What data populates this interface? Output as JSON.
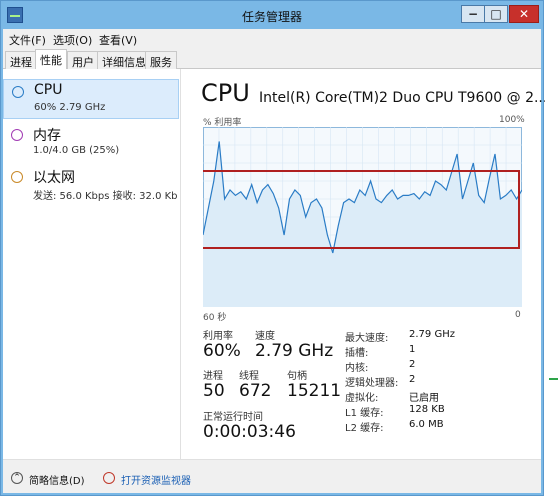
{
  "window": {
    "title": "任务管理器"
  },
  "menu": [
    "文件(F)",
    "选项(O)",
    "查看(V)"
  ],
  "tabs": [
    "进程",
    "性能",
    "用户",
    "详细信息",
    "服务"
  ],
  "active_tab": 1,
  "sidebar": [
    {
      "name": "CPU",
      "detail": "60% 2.79 GHz",
      "color": "#2a7cc6"
    },
    {
      "name": "内存",
      "detail": "1.0/4.0 GB (25%)",
      "color": "#a23cb4"
    },
    {
      "name": "以太网",
      "detail": "发送: 56.0 Kbps 接收: 32.0 Kb",
      "color": "#c98a2a"
    }
  ],
  "main": {
    "title": "CPU",
    "model": "Intel(R) Core(TM)2 Duo CPU T9600 @ 2...",
    "graph_label_left": "% 利用率",
    "graph_label_right": "100%",
    "graph_label_bottom_left": "60 秒",
    "graph_label_bottom_right": "0"
  },
  "stats": {
    "util_label": "利用率",
    "util_value": "60%",
    "speed_label": "速度",
    "speed_value": "2.79 GHz",
    "proc_label": "进程",
    "proc_value": "50",
    "thread_label": "线程",
    "thread_value": "672",
    "handle_label": "句柄",
    "handle_value": "15211",
    "uptime_label": "正常运行时间",
    "uptime_value": "0:00:03:46"
  },
  "details": [
    {
      "label": "最大速度:",
      "value": "2.79 GHz"
    },
    {
      "label": "插槽:",
      "value": "1"
    },
    {
      "label": "内核:",
      "value": "2"
    },
    {
      "label": "逻辑处理器:",
      "value": "2"
    },
    {
      "label": "虚拟化:",
      "value": "已启用"
    },
    {
      "label": "L1 缓存:",
      "value": "128 KB"
    },
    {
      "label": "L2 缓存:",
      "value": "6.0 MB"
    }
  ],
  "footer": {
    "brief": "简略信息(D)",
    "monitor": "打开资源监视器"
  },
  "chart_data": {
    "type": "line",
    "title": "",
    "ylabel": "% 利用率",
    "ylim": [
      0,
      100
    ],
    "xlim": [
      60,
      0
    ],
    "x_label_left": "60 秒",
    "series": [
      {
        "values": [
          40,
          55,
          70,
          92,
          60,
          65,
          62,
          64,
          60,
          68,
          58,
          65,
          68,
          63,
          55,
          40,
          60,
          65,
          62,
          50,
          58,
          60,
          55,
          40,
          30,
          45,
          58,
          60,
          58,
          65,
          62,
          70,
          60,
          58,
          62,
          65,
          60,
          62,
          62,
          63,
          60,
          64,
          62,
          70,
          68,
          65,
          75,
          85,
          60,
          70,
          80,
          62,
          58,
          72,
          85,
          60,
          62,
          65,
          60,
          65
        ],
        "color": "#2a7cc6"
      }
    ]
  },
  "colors": {
    "accent": "#2a7cc6",
    "annotation": "#b02020",
    "titlebar": "#7ab8e6"
  }
}
